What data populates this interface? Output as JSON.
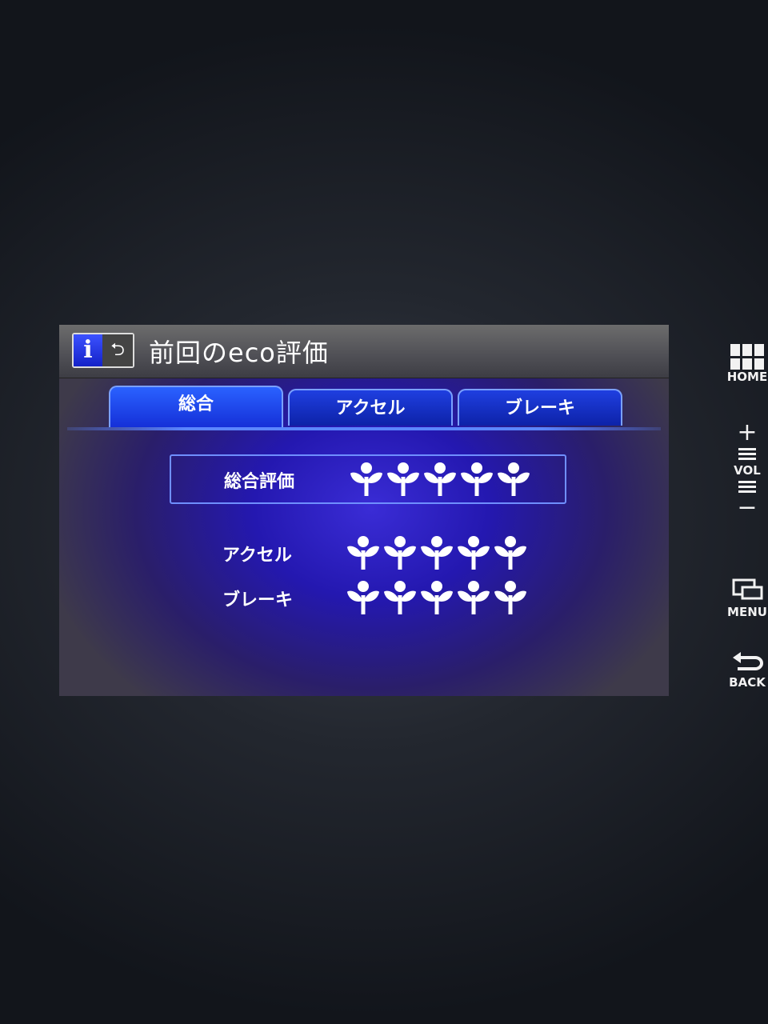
{
  "header": {
    "title": "前回のeco評価",
    "info_icon": "info-icon",
    "back_icon": "return-arrow-icon"
  },
  "tabs": [
    {
      "label": "総合",
      "active": true
    },
    {
      "label": "アクセル",
      "active": false
    },
    {
      "label": "ブレーキ",
      "active": false
    }
  ],
  "ratings": {
    "overall": {
      "label": "総合評価",
      "leaves": 5,
      "max": 5
    },
    "accel": {
      "label": "アクセル",
      "leaves": 5,
      "max": 5
    },
    "brake": {
      "label": "ブレーキ",
      "leaves": 5,
      "max": 5
    }
  },
  "side_buttons": {
    "home": "HOME",
    "vol_plus": "+",
    "vol": "VOL",
    "vol_minus": "−",
    "menu": "MENU",
    "back": "BACK"
  },
  "colors": {
    "accent": "#2a62ff",
    "leaf": "#ffffff"
  }
}
